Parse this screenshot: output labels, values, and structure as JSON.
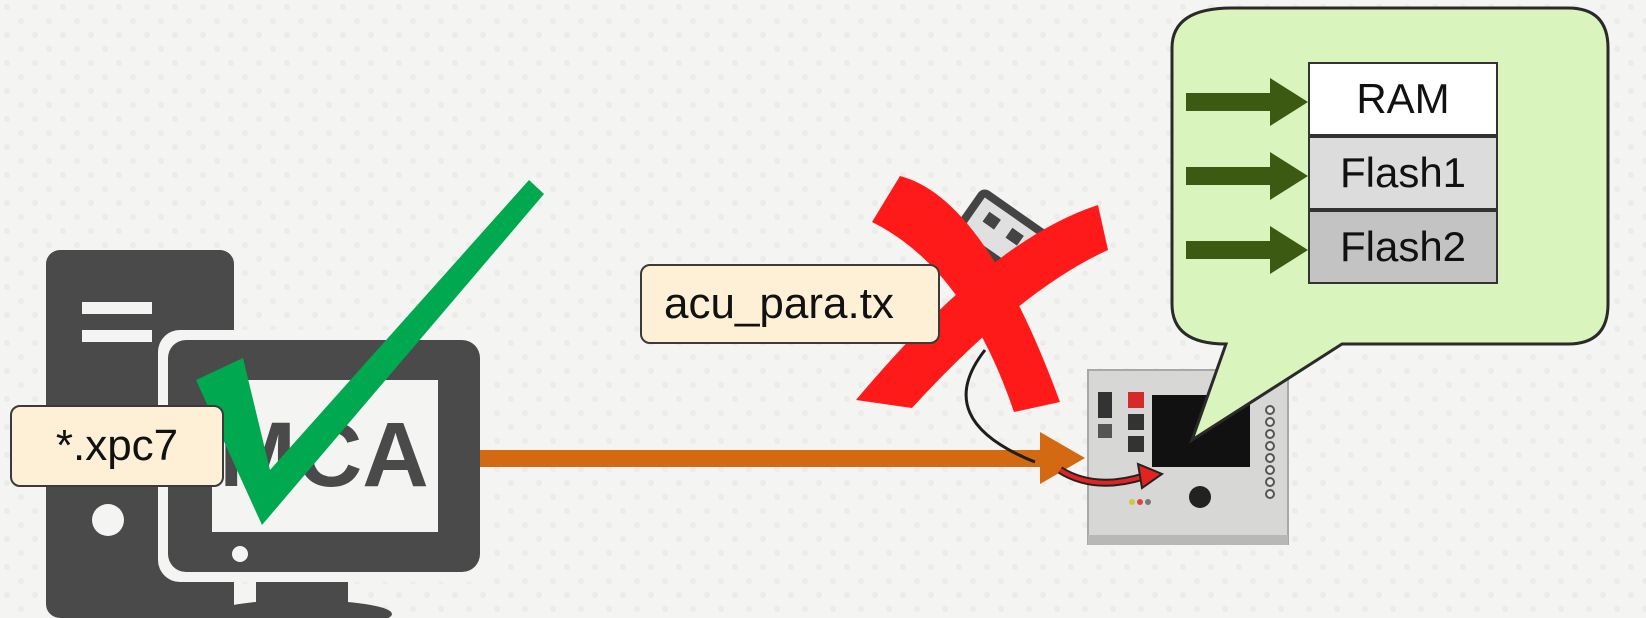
{
  "labels": {
    "source_file": "*.xpc7",
    "param_file": "acu_para.tx",
    "pc_text": "MCA"
  },
  "memory": {
    "items": [
      "RAM",
      "Flash1",
      "Flash2"
    ],
    "fills": [
      "#ffffff",
      "#dcdcdc",
      "#c3c3c3"
    ]
  },
  "colors": {
    "bubble_fill": "#d9f4bd",
    "arrow_transfer": "#d36a12",
    "arrow_memory": "#3d5a12",
    "check": "#00a94f",
    "cross": "#ff1a1a",
    "pc_icon": "#4a4a4a"
  },
  "icons": [
    "desktop-pc-icon",
    "checkmark-icon",
    "usb-plug-icon",
    "red-x-icon",
    "control-device-icon"
  ]
}
